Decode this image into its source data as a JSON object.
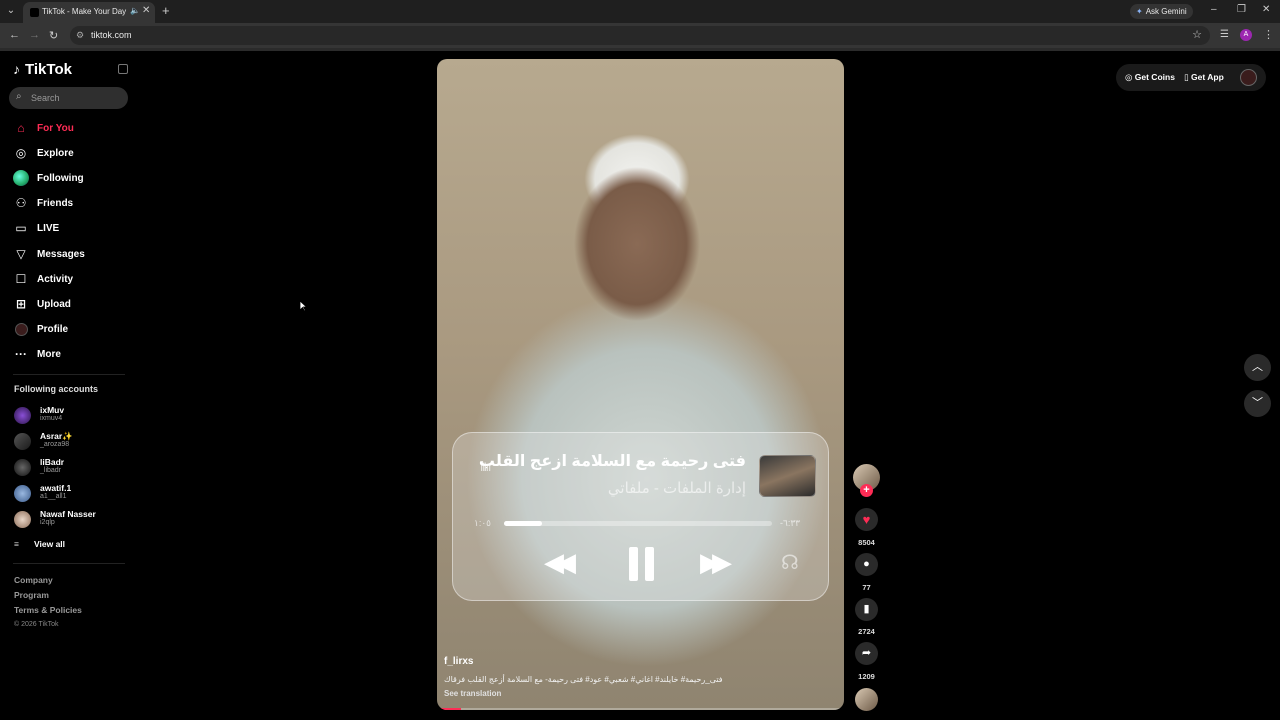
{
  "browser": {
    "tab_title": "TikTok - Make Your Day",
    "url": "tiktok.com",
    "gemini_label": "Ask Gemini",
    "profile_initial": "A"
  },
  "sidebar": {
    "logo_text": "TikTok",
    "search_placeholder": "Search",
    "nav": [
      {
        "label": "For You",
        "icon": "home-icon",
        "active": true
      },
      {
        "label": "Explore",
        "icon": "compass-icon"
      },
      {
        "label": "Following",
        "icon": "following-avatar"
      },
      {
        "label": "Friends",
        "icon": "friends-icon"
      },
      {
        "label": "LIVE",
        "icon": "live-icon"
      },
      {
        "label": "Messages",
        "icon": "messages-icon"
      },
      {
        "label": "Activity",
        "icon": "activity-icon"
      },
      {
        "label": "Upload",
        "icon": "upload-icon"
      },
      {
        "label": "Profile",
        "icon": "profile-avatar"
      },
      {
        "label": "More",
        "icon": "more-icon"
      }
    ],
    "following_title": "Following accounts",
    "accounts": [
      {
        "name": "ixMuv",
        "handle": "ixmuv4"
      },
      {
        "name": "Asrar✨",
        "handle": "_aroza98"
      },
      {
        "name": "liBadr",
        "handle": "_libadr"
      },
      {
        "name": "awatif.1",
        "handle": "a1__all1"
      },
      {
        "name": "Nawaf Nasser",
        "handle": "i2qlp"
      }
    ],
    "view_all": "View all",
    "footer": [
      "Company",
      "Program",
      "Terms & Policies"
    ],
    "copyright": "© 2026 TikTok"
  },
  "topbar": {
    "get_coins": "Get Coins",
    "get_app": "Get App"
  },
  "video": {
    "username": "f_lirxs",
    "caption": "فتى_رحيمة# خايلند# اغاني# شعبي# عود# فتى رحيمة- مع السلامة أزعج القلب فرقاك",
    "see_translation": "See translation",
    "progress": 0.06
  },
  "player": {
    "song_title": "فتى رحيمة   مع السلامة ازعج القلب",
    "artist": "إدارة الملفات - ملفاتي",
    "time_elapsed": "١:٠٥",
    "time_remaining": "-٦:٣٣",
    "progress": 0.14
  },
  "actions": {
    "likes": "8504",
    "comments": "77",
    "saves": "2724",
    "shares": "1209"
  }
}
